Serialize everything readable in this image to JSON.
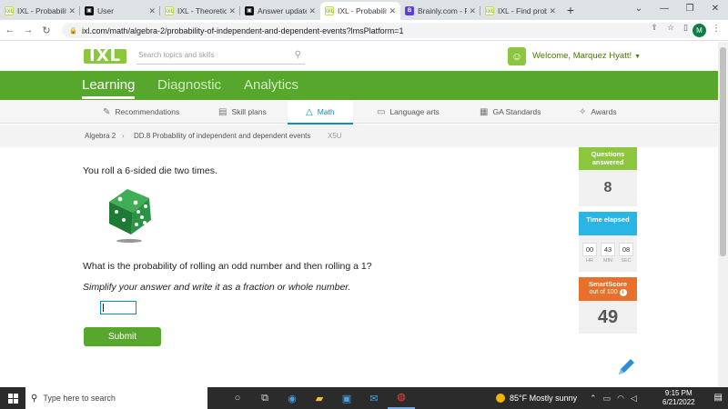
{
  "browser": {
    "tabs": [
      {
        "title": "IXL - Probabilit",
        "favicon": "ixl",
        "active": false
      },
      {
        "title": "User",
        "favicon": "bk",
        "active": false
      },
      {
        "title": "IXL - Theoretic",
        "favicon": "ixl",
        "active": false
      },
      {
        "title": "Answer update",
        "favicon": "bk",
        "active": false
      },
      {
        "title": "IXL - Probabilit",
        "favicon": "ixl",
        "active": true
      },
      {
        "title": "Brainly.com - F",
        "favicon": "br",
        "active": false
      },
      {
        "title": "IXL - Find prob",
        "favicon": "ixl",
        "active": false
      }
    ],
    "url": "ixl.com/math/algebra-2/probability-of-independent-and-dependent-events?lmsPlatform=1",
    "profile_initial": "M"
  },
  "ixl": {
    "logo": "IXL",
    "search_placeholder": "Search topics and skills",
    "welcome": "Welcome, Marquez Hyatt!",
    "main_nav": [
      "Learning",
      "Diagnostic",
      "Analytics"
    ],
    "sub_nav": [
      "Recommendations",
      "Skill plans",
      "Math",
      "Language arts",
      "GA Standards",
      "Awards"
    ],
    "breadcrumb": {
      "course": "Algebra 2",
      "skill": "DD.8 Probability of independent and dependent events",
      "code": "X5U"
    }
  },
  "question": {
    "intro": "You roll a 6-sided die two times.",
    "prompt": "What is the probability of rolling an odd number and then rolling a 1?",
    "instruction": "Simplify your answer and write it as a fraction or whole number.",
    "answer_value": "",
    "submit_label": "Submit"
  },
  "stats": {
    "questions_label": "Questions answered",
    "questions_value": "8",
    "time_label": "Time elapsed",
    "time": {
      "hr": "00",
      "min": "43",
      "sec": "08"
    },
    "time_units": {
      "hr": "HR",
      "min": "MIN",
      "sec": "SEC"
    },
    "smartscore_label": "SmartScore",
    "smartscore_sub": "out of 100",
    "smartscore_value": "49"
  },
  "taskbar": {
    "search_placeholder": "Type here to search",
    "weather": "85°F  Mostly sunny",
    "time": "9:15 PM",
    "date": "6/21/2022"
  },
  "colors": {
    "ixl_green": "#56a72b",
    "accent_blue": "#0a8fc7",
    "smartscore_orange": "#e8702a"
  }
}
